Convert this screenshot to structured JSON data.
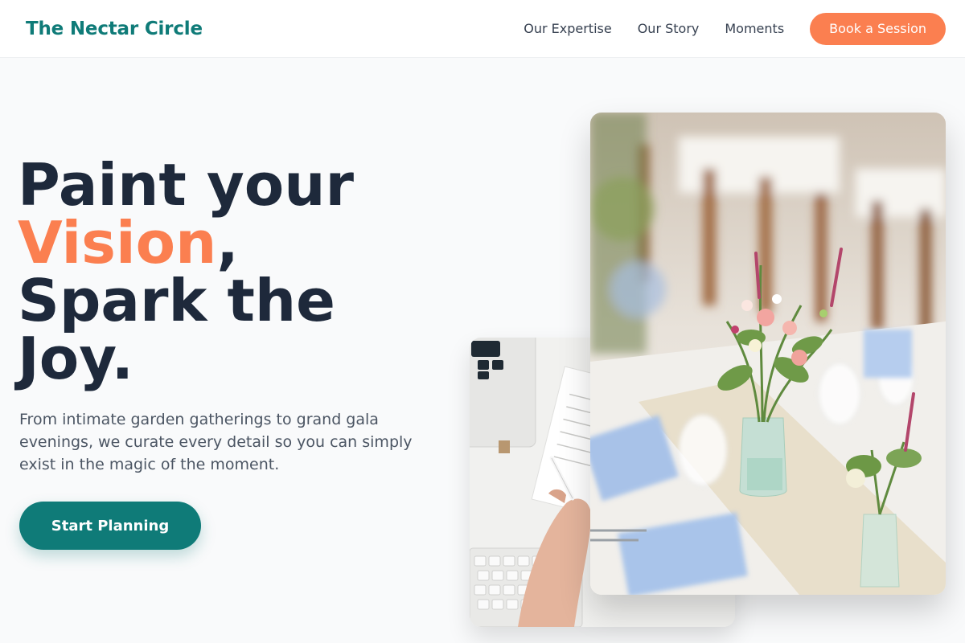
{
  "nav": {
    "brand": "The Nectar Circle",
    "links": [
      "Our Expertise",
      "Our Story",
      "Moments"
    ],
    "cta": "Book a Session"
  },
  "hero": {
    "heading_line1": "Paint your",
    "heading_accent": "Vision",
    "heading_comma": ",",
    "heading_line3": "Spark the",
    "heading_line4": "Joy.",
    "subtitle": "From intimate garden gatherings to grand gala evenings, we curate every detail so you can simply exist in the magic of the moment.",
    "cta": "Start Planning"
  },
  "colors": {
    "brand": "#0f7b78",
    "accent": "#fb7f50",
    "heading": "#1e293b",
    "body_text": "#4b5563",
    "background": "#f9fafb"
  },
  "images": {
    "back": "desk-laptop-planning-photo",
    "front": "wedding-table-flowers-photo"
  }
}
